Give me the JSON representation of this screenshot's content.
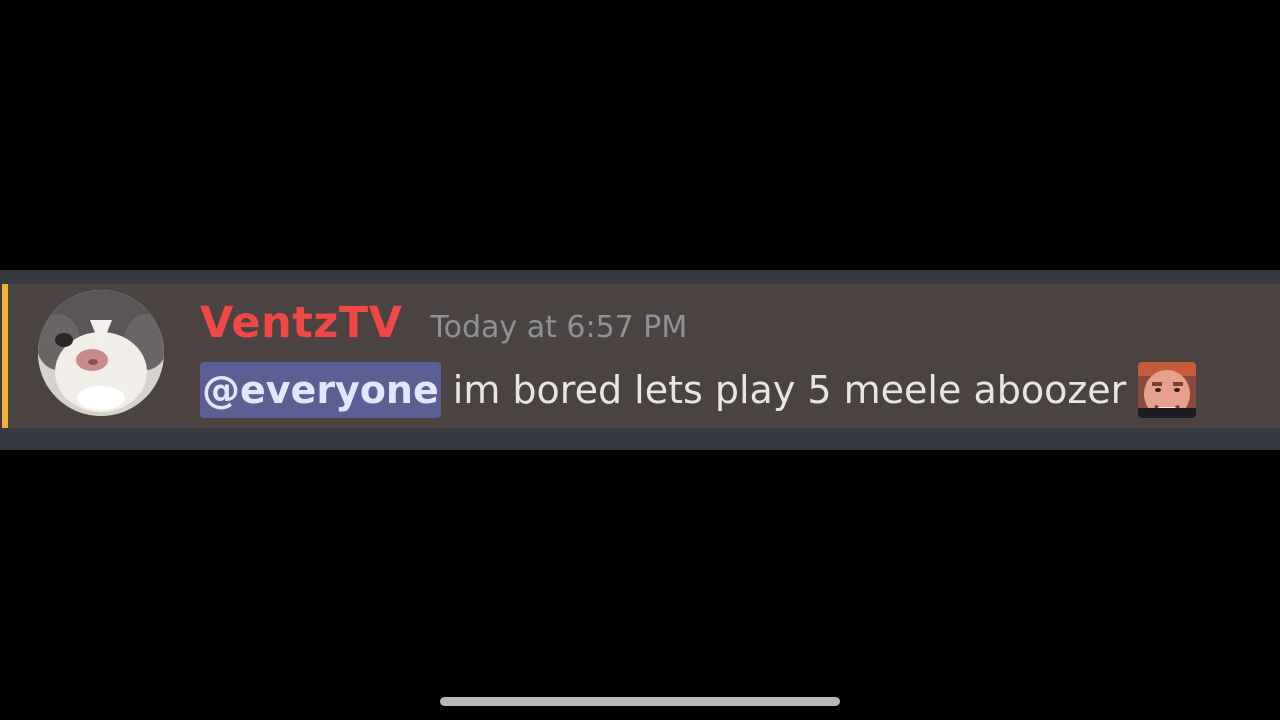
{
  "message": {
    "author": "VentzTV",
    "timestamp": "Today at 6:57 PM",
    "mention": "@everyone",
    "text": "im bored lets play 5 meele aboozer",
    "avatar_icon": "cat-avatar-icon",
    "emoji_icon": "face-emoji-icon"
  },
  "colors": {
    "author": "#f04747",
    "accent_bar": "#f0b232",
    "message_bg": "#4a4341",
    "mention_bg": "#5b5f93"
  }
}
